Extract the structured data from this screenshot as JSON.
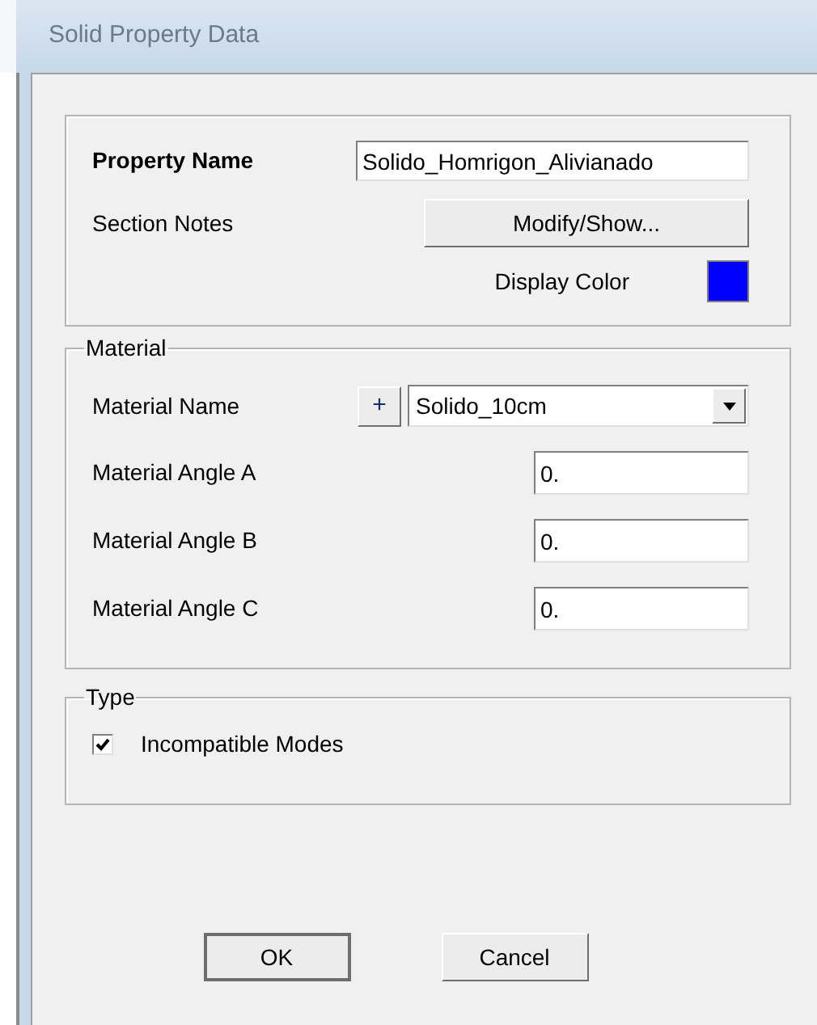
{
  "window": {
    "title": "Solid Property Data"
  },
  "general": {
    "property_name_label": "Property Name",
    "property_name": "Solido_Homrigon_Alivianado",
    "section_notes_label": "Section Notes",
    "notes_button": "Modify/Show...",
    "display_color_label": "Display Color",
    "color": "#0000ff"
  },
  "material": {
    "title": "Material",
    "name_label": "Material Name",
    "add_button": "+",
    "material_name": "Solido_10cm",
    "angles": [
      {
        "label": "Material Angle A",
        "value": "0."
      },
      {
        "label": "Material Angle B",
        "value": "0."
      },
      {
        "label": "Material Angle C",
        "value": "0."
      }
    ]
  },
  "type": {
    "title": "Type",
    "options": [
      {
        "label": "Incompatible Modes",
        "checked": true
      }
    ]
  },
  "buttons": [
    {
      "label": "OK",
      "default": true
    },
    {
      "label": "Cancel",
      "default": false
    }
  ]
}
